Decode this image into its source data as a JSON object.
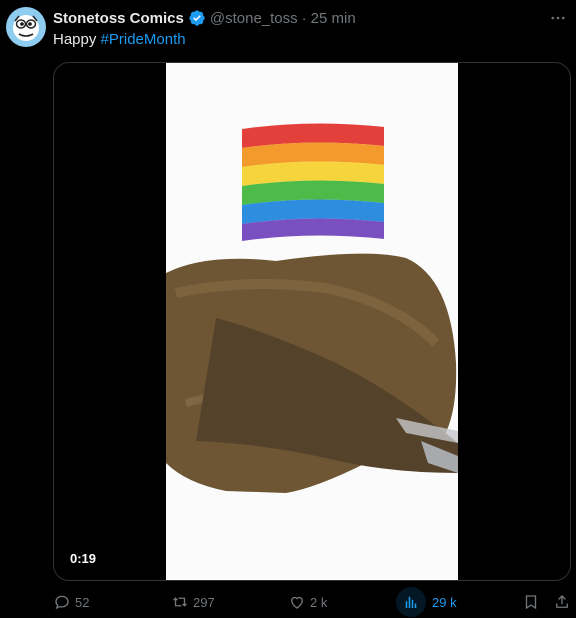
{
  "post": {
    "author_name": "Stonetoss Comics",
    "handle": "@stone_toss",
    "separator": "·",
    "time": "25 min",
    "text_prefix": "Happy",
    "hashtag": "#PrideMonth"
  },
  "media": {
    "duration": "0:19"
  },
  "actions": {
    "replies": "52",
    "reposts": "297",
    "likes": "2 k",
    "views": "29 k"
  },
  "icons": {
    "more": "more-dots-icon",
    "verified": "verified-badge-icon",
    "reply": "reply-icon",
    "repost": "repost-icon",
    "like": "heart-icon",
    "views": "views-chart-icon",
    "bookmark": "bookmark-icon",
    "share": "share-icon"
  },
  "colors": {
    "accent": "#1d9bf0",
    "muted": "#71767b",
    "text": "#e7e9ea"
  }
}
